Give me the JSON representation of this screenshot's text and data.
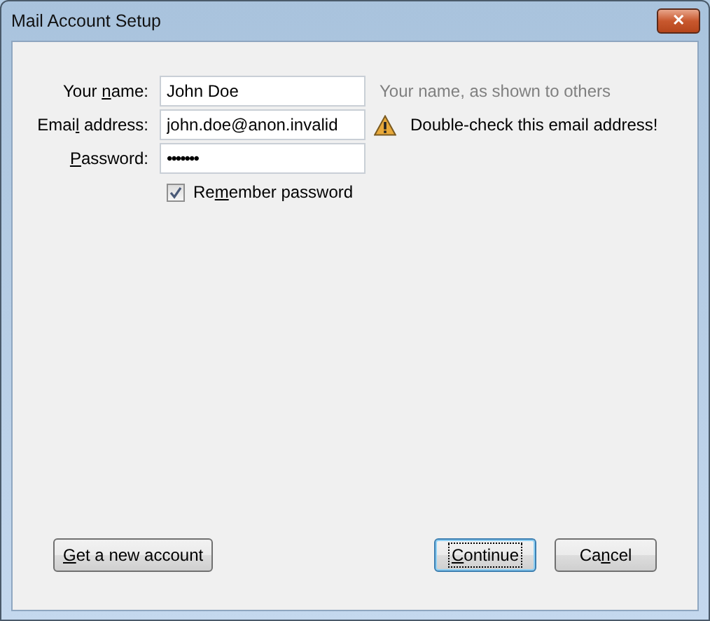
{
  "window": {
    "title": "Mail Account Setup",
    "close_symbol": "✕"
  },
  "fields": [
    {
      "label": {
        "before": "Your ",
        "key": "n",
        "after": "ame:"
      },
      "kind": "text",
      "value": "John Doe",
      "hint": {
        "kind": "info",
        "text": "Your name, as shown to others"
      }
    },
    {
      "label": {
        "before": "Emai",
        "key": "l",
        "after": " address:"
      },
      "kind": "text",
      "value": "john.doe@anon.invalid",
      "hint": {
        "kind": "warning",
        "text": "Double-check this email address!"
      }
    },
    {
      "label": {
        "key": "P",
        "after": "assword:"
      },
      "kind": "password",
      "value": "•••••••"
    }
  ],
  "remember": {
    "label": {
      "before": "Re",
      "key": "m",
      "after": "ember password"
    },
    "checked": true
  },
  "left_buttons": [
    {
      "label": {
        "key": "G",
        "after": "et a new account"
      },
      "focused": false
    }
  ],
  "right_buttons": [
    {
      "label": {
        "key": "C",
        "after": "ontinue"
      },
      "focused": true
    },
    {
      "label": {
        "before": "Ca",
        "key": "n",
        "after": "cel"
      },
      "focused": false
    }
  ]
}
